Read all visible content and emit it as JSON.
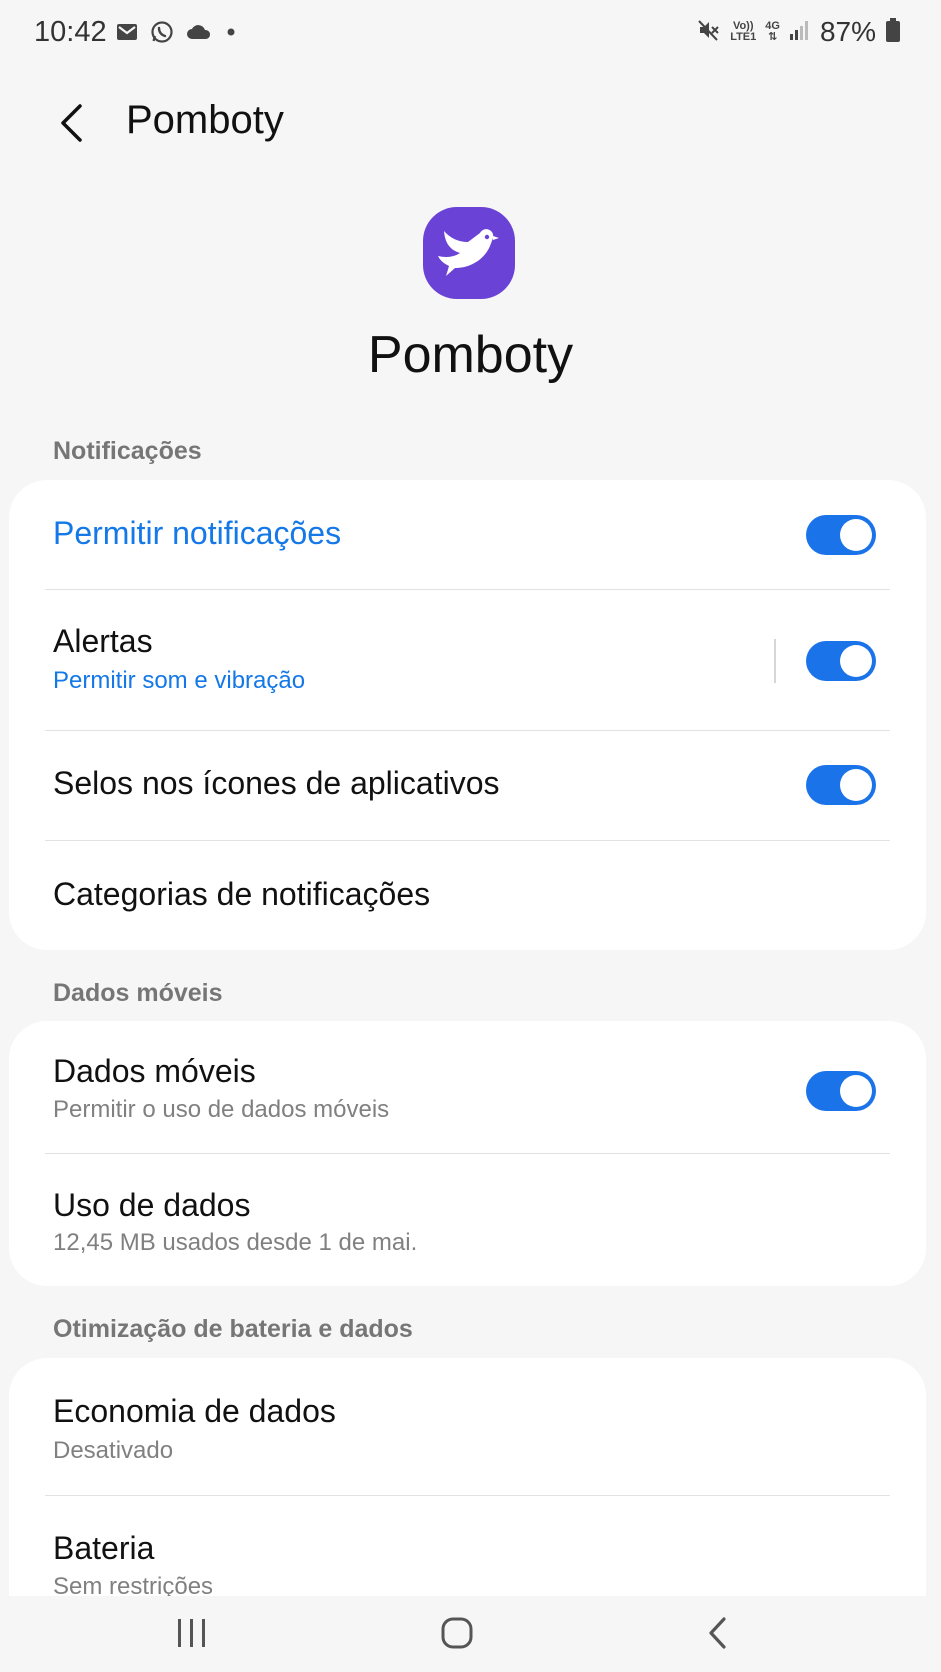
{
  "status_bar": {
    "time": "10:42",
    "battery": "87%",
    "left_icons": [
      "gmail-icon",
      "whatsapp-icon",
      "cloud-icon",
      "dot-icon"
    ],
    "right_icons": [
      "mute-icon",
      "volte-icon",
      "4g-icon",
      "signal-icon",
      "battery-icon"
    ],
    "volte_top": "Vo))",
    "volte_bottom": "LTE1",
    "network": "4G"
  },
  "header": {
    "title": "Pomboty"
  },
  "app": {
    "name": "Pomboty",
    "icon_color": "#6a42d6"
  },
  "sections": {
    "notifications": {
      "label": "Notificações",
      "allow": {
        "title": "Permitir notificações",
        "enabled": true
      },
      "alerts": {
        "title": "Alertas",
        "subtitle": "Permitir som e vibração",
        "enabled": true
      },
      "badges": {
        "title": "Selos nos ícones de aplicativos",
        "enabled": true
      },
      "categories": {
        "title": "Categorias de notificações"
      }
    },
    "mobile_data": {
      "label": "Dados móveis",
      "mobile": {
        "title": "Dados móveis",
        "subtitle": "Permitir o uso de dados móveis",
        "enabled": true
      },
      "usage": {
        "title": "Uso de dados",
        "subtitle": "12,45 MB usados desde 1 de mai."
      }
    },
    "optimization": {
      "label": "Otimização de bateria e dados",
      "data_saver": {
        "title": "Economia de dados",
        "subtitle": "Desativado"
      },
      "battery": {
        "title": "Bateria",
        "subtitle": "Sem restrições"
      }
    }
  },
  "colors": {
    "accent": "#1478e8",
    "toggle_on": "#1a73e8",
    "background": "#f6f6f6"
  }
}
